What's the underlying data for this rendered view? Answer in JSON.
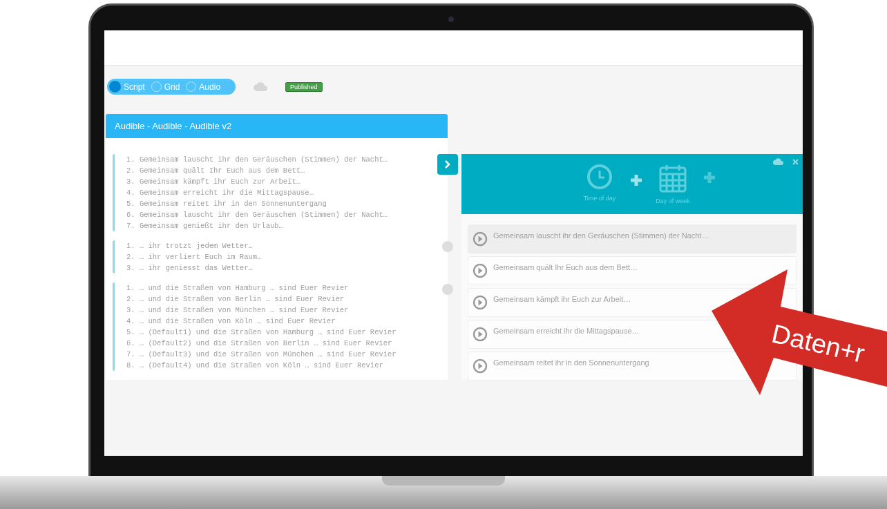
{
  "mode_toggle": [
    {
      "label": "Script",
      "selected": true
    },
    {
      "label": "Grid",
      "selected": false
    },
    {
      "label": "Audio",
      "selected": false
    }
  ],
  "status_badge": "Published",
  "script_panel": {
    "title": "Audible - Audible - Audible v2",
    "groups": [
      {
        "lines": [
          "1. Gemeinsam lauscht ihr den Geräuschen (Stimmen) der Nacht…",
          "2. Gemeinsam quält Ihr Euch aus dem Bett…",
          "3. Gemeinsam kämpft ihr Euch zur Arbeit…",
          "4. Gemeinsam erreicht ihr die Mittagspause…",
          "5. Gemeinsam reitet ihr in den Sonnenuntergang",
          "6. Gemeinsam lauscht ihr den Geräuschen (Stimmen) der Nacht…",
          "7. Gemeinsam genießt ihr den Urlaub…"
        ]
      },
      {
        "lines": [
          "1. … ihr trotzt jedem Wetter…",
          "2. … ihr verliert Euch im Raum…",
          "3. … ihr geniesst das Wetter…"
        ]
      },
      {
        "lines": [
          "1. … und die Straßen von Hamburg … sind Euer Revier",
          "2. … und die Straßen von Berlin … sind Euer Revier",
          "3. … und die Straßen von München … sind Euer Revier",
          "4. … und die Straßen von Köln … sind Euer Revier",
          "5. … (Default1) und die Straßen von Hamburg … sind Euer Revier",
          "6. … (Default2) und die Straßen von Berlin … sind Euer Revier",
          "7. … (Default3) und die Straßen von München … sind Euer Revier",
          "8. … (Default4) und die Straßen von Köln … sind Euer Revier"
        ]
      }
    ]
  },
  "schedule_panel": {
    "conditions": [
      {
        "kind": "clock",
        "label": "Time of day"
      },
      {
        "kind": "calendar",
        "label": "Day of week"
      }
    ],
    "items": [
      {
        "text": "Gemeinsam lauscht ihr den Geräuschen (Stimmen) der Nacht…",
        "selected": true
      },
      {
        "text": "Gemeinsam quält Ihr Euch aus dem Bett…",
        "selected": false
      },
      {
        "text": "Gemeinsam kämpft ihr Euch zur Arbeit…",
        "selected": false
      },
      {
        "text": "Gemeinsam erreicht ihr die Mittagspause…",
        "selected": false
      },
      {
        "text": "Gemeinsam reitet ihr in den Sonnenuntergang",
        "selected": false
      }
    ]
  },
  "annotation": {
    "text": "Daten+r"
  }
}
